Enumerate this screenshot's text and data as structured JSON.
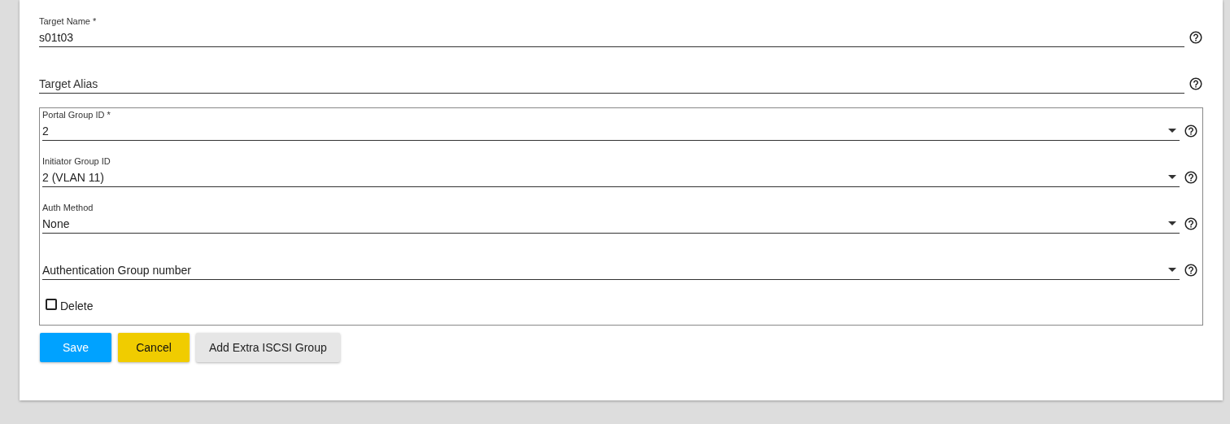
{
  "fields": [
    {
      "kind": "text",
      "label": "Target Name *",
      "value": "s01t03"
    },
    {
      "kind": "text",
      "placeholder": "Target Alias"
    }
  ],
  "group": {
    "selects": [
      {
        "label": "Portal Group ID *",
        "value": "2"
      },
      {
        "label": "Initiator Group ID",
        "value": "2 (VLAN 11)"
      },
      {
        "label": "Auth Method",
        "value": "None"
      },
      {
        "placeholder": "Authentication Group number"
      }
    ],
    "checkbox": {
      "label": "Delete",
      "checked": false
    }
  },
  "buttons": [
    {
      "label": "Save",
      "kind": "primary"
    },
    {
      "label": "Cancel",
      "kind": "warning"
    },
    {
      "label": "Add Extra ISCSI Group",
      "kind": "default"
    }
  ]
}
